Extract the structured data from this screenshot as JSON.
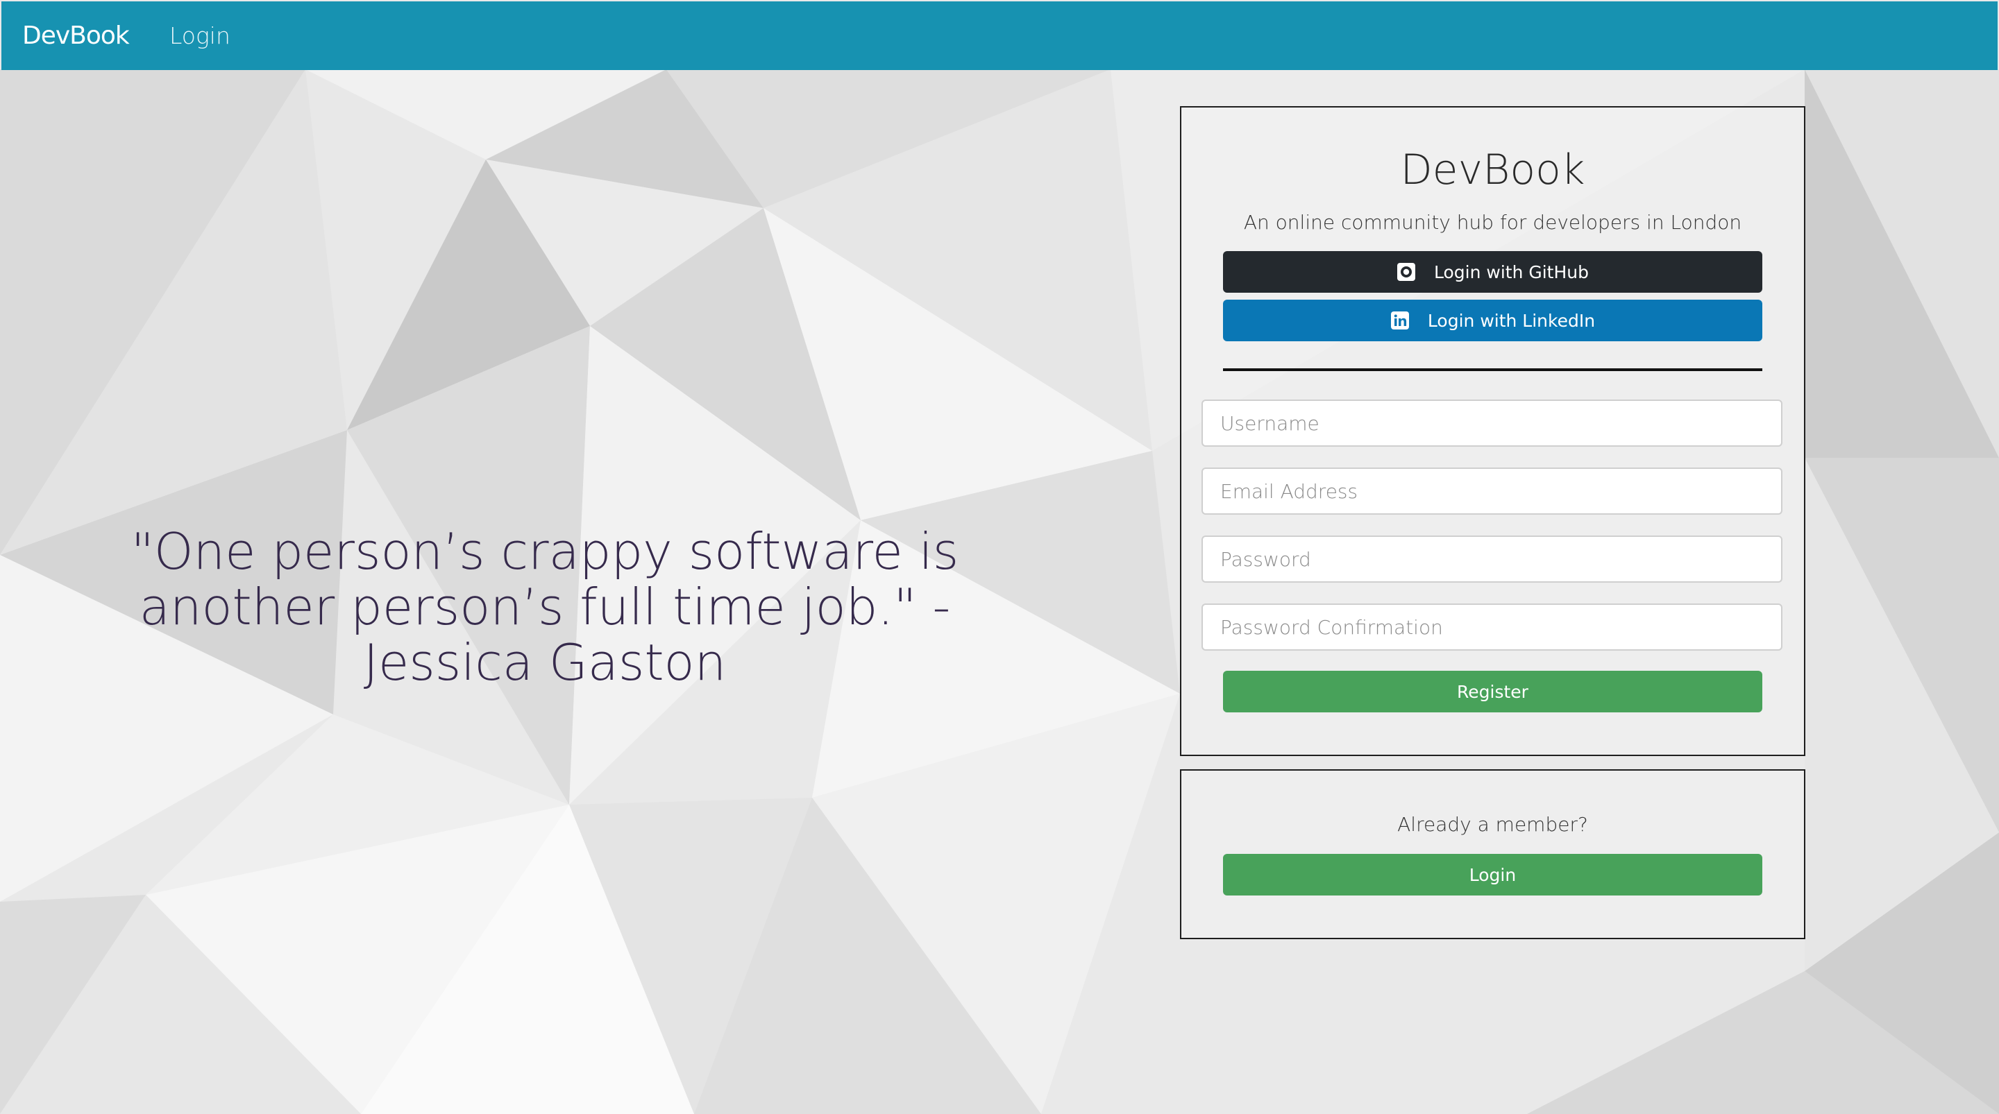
{
  "navbar": {
    "brand": "DevBook",
    "login_link": "Login"
  },
  "quote": {
    "text": "\"One person’s crappy software is another person’s full time job.\" -Jessica Gaston"
  },
  "register_card": {
    "title": "DevBook",
    "subtitle": "An online community hub for developers in London",
    "github_button": {
      "label": "Login with GitHub",
      "icon": "github-icon"
    },
    "linkedin_button": {
      "label": "Login with LinkedIn",
      "icon": "linkedin-icon"
    },
    "fields": {
      "username": {
        "placeholder": "Username",
        "value": ""
      },
      "email": {
        "placeholder": "Email Address",
        "value": ""
      },
      "password": {
        "placeholder": "Password",
        "value": ""
      },
      "password_confirmation": {
        "placeholder": "Password Confirmation",
        "value": ""
      }
    },
    "register_button": "Register"
  },
  "login_card": {
    "text": "Already a member?",
    "login_button": "Login"
  },
  "colors": {
    "navbar": "#1792b1",
    "github": "#24292e",
    "linkedin": "#0a77b5",
    "success": "#48a25a",
    "quote": "#362a4c"
  }
}
